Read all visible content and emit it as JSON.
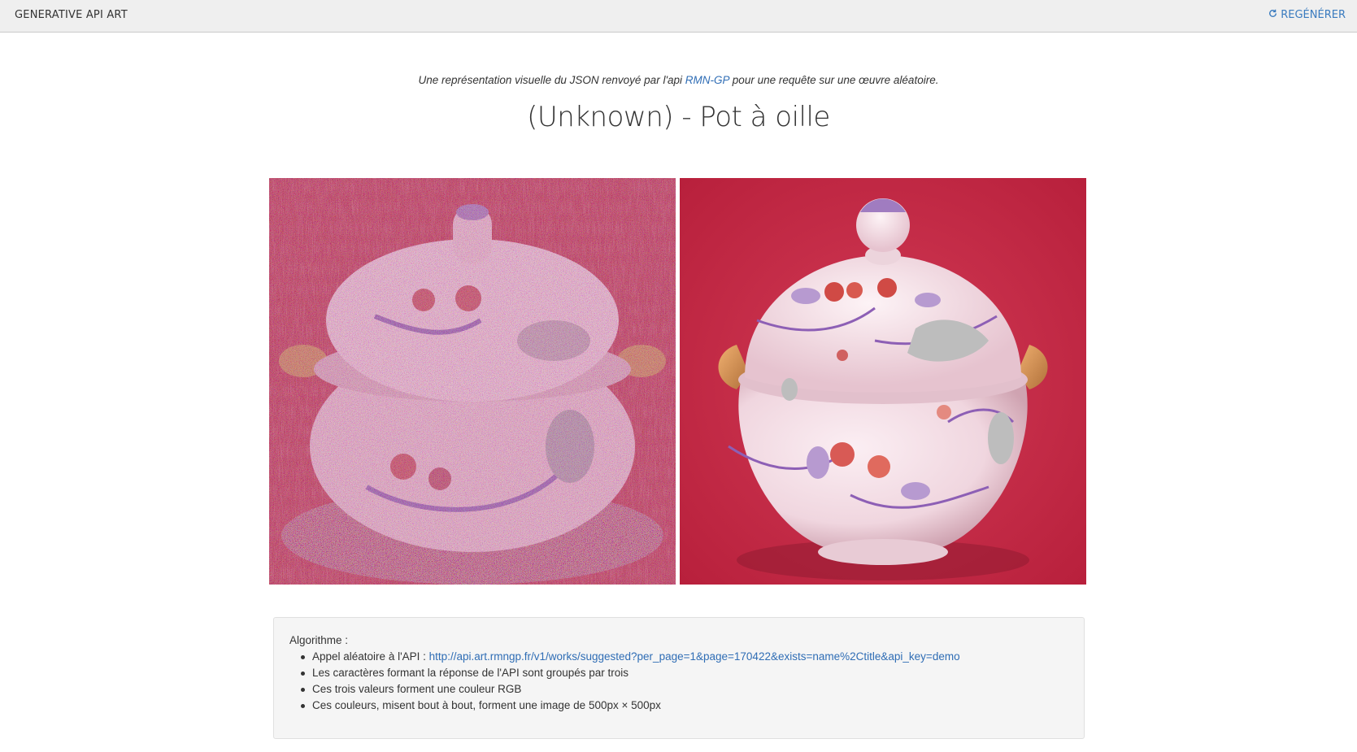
{
  "navbar": {
    "brand": "GENERATIVE API ART",
    "regenerate_label": "REGÉNÉRER",
    "regenerate_icon": "refresh-icon",
    "accent_color": "#3a7bbf"
  },
  "header": {
    "subtitle_before": "Une représentation visuelle du JSON renvoyé par l'api ",
    "subtitle_link": "RMN-GP",
    "subtitle_after": " pour une requête sur une œuvre aléatoire.",
    "title": "(Unknown) - Pot à oille"
  },
  "images": {
    "generated_background": "#c0243e",
    "artwork_background": "#c42840"
  },
  "algorithm": {
    "label": "Algorithme :",
    "steps": [
      {
        "text": "Appel aléatoire à l'API : ",
        "link": "http://api.art.rmngp.fr/v1/works/suggested?per_page=1&page=170422&exists=name%2Ctitle&api_key=demo"
      },
      {
        "text": "Les caractères formant la réponse de l'API sont groupés par trois"
      },
      {
        "text": "Ces trois valeurs forment une couleur RGB"
      },
      {
        "text": "Ces couleurs, misent bout à bout, forment une image de 500px × 500px"
      }
    ]
  }
}
